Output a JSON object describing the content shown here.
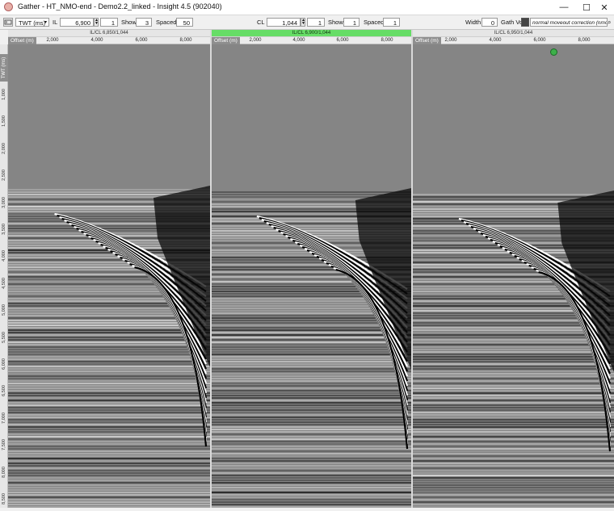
{
  "window": {
    "title": "Gather - HT_NMO-end - Demo2.2_linked - Insight 4.5 (902040)",
    "minimize": "—",
    "maximize": "☐",
    "close": "✕"
  },
  "toolbar": {
    "axis_select": "TWT (ms)",
    "il_label": "IL",
    "il_value": "6,900",
    "il_step": "1",
    "il_show_label": "Show",
    "il_show": "3",
    "il_spaced_label": "Spaced",
    "il_spaced": "50",
    "cl_label": "CL",
    "cl_value": "1,044",
    "cl_step": "1",
    "cl_show_label": "Show",
    "cl_show": "1",
    "cl_spaced_label": "Spaced",
    "cl_spaced": "1",
    "width_label": "Width",
    "width_value": "0",
    "gath_vol_label": "Gath Vol",
    "gath_vol_value": "normal moveout correction (nmo)"
  },
  "panels": [
    {
      "header": "IL/CL 6,850/1,044",
      "active": false
    },
    {
      "header": "IL/CL 6,900/1,044",
      "active": true
    },
    {
      "header": "IL/CL 6,950/1,044",
      "active": false
    }
  ],
  "x_axis": {
    "title": "Offset (m)",
    "ticks": [
      "2,000",
      "4,000",
      "6,000",
      "8,000"
    ]
  },
  "y_axis": {
    "title": "TWT (ms)",
    "ticks": [
      "1,000",
      "1,500",
      "2,000",
      "2,500",
      "3,000",
      "3,500",
      "4,000",
      "4,500",
      "5,000",
      "5,500",
      "6,000",
      "6,500",
      "7,000",
      "7,500",
      "8,000",
      "8,500"
    ]
  },
  "colors": {
    "active_header": "#66dd66",
    "background_gray": "#858585"
  }
}
